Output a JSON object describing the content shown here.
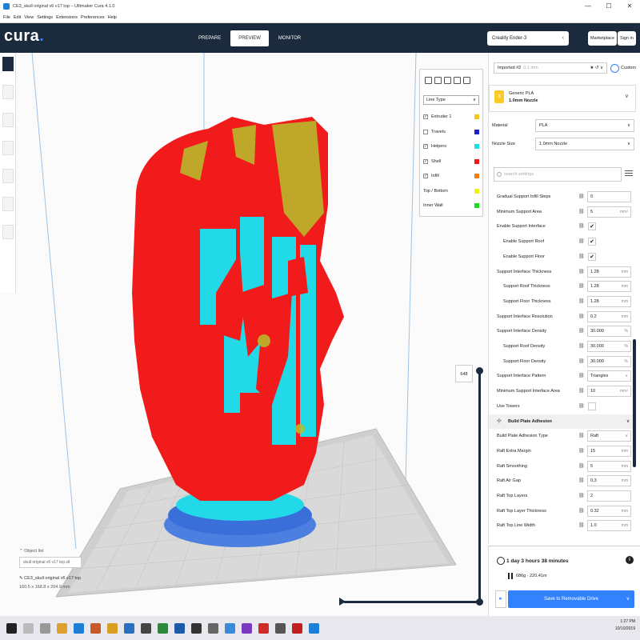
{
  "window": {
    "title": "CE3_skull original v6 v17 top – Ultimaker Cura 4.1.0",
    "controls": [
      "—",
      "☐",
      "✕"
    ]
  },
  "menu": [
    "File",
    "Edit",
    "View",
    "Settings",
    "Extensions",
    "Preferences",
    "Help"
  ],
  "header": {
    "logo": "cura",
    "stages": [
      "PREPARE",
      "PREVIEW",
      "MONITOR"
    ],
    "active_stage": "PREVIEW",
    "printer": "Creality Ender-3",
    "marketplace": "Marketplace",
    "signin": "Sign in"
  },
  "viewpanel": {
    "color_scheme": "Line Type",
    "rows": [
      {
        "label": "Extruder 1",
        "checked": true,
        "color": "#f5c518"
      },
      {
        "label": "Travels",
        "checked": false,
        "color": "#1f1fc8"
      },
      {
        "label": "Helpers",
        "checked": true,
        "color": "#1ee0e0"
      },
      {
        "label": "Shell",
        "checked": true,
        "color": "#f01818"
      },
      {
        "label": "Infill",
        "checked": true,
        "color": "#f08018"
      },
      {
        "label": "Top / Bottom",
        "checked": null,
        "color": "#f0f018"
      },
      {
        "label": "Inner Wall",
        "checked": null,
        "color": "#18e018"
      }
    ]
  },
  "layer": {
    "current": "648",
    "check": "✓"
  },
  "objects": {
    "header": "Object list",
    "item": "skull original v6 v17 top.stl",
    "file": "CE3_skull original v6 v17 top",
    "dims": "160.5 x 168.8 x 204.9 mm"
  },
  "panel": {
    "profile_name": "Imported #2",
    "profile_sub": "0.1 mm",
    "custom": "Custom",
    "extruder_num": "1",
    "material_name": "Generic PLA",
    "nozzle_name": "1.0mm Nozzle",
    "material_label": "Material",
    "material_value": "PLA",
    "nozzle_label": "Nozzle Size",
    "nozzle_value": "1.0mm Nozzle",
    "search_placeholder": "search settings",
    "settings": [
      {
        "label": "Gradual Support Infill Steps",
        "indent": 0,
        "type": "value",
        "value": "0",
        "unit": ""
      },
      {
        "label": "Minimum Support Area",
        "indent": 0,
        "type": "value",
        "value": "5",
        "unit": "mm²"
      },
      {
        "label": "Enable Support Interface",
        "indent": 0,
        "type": "check",
        "value": "✔",
        "unit": ""
      },
      {
        "label": "Enable Support Roof",
        "indent": 1,
        "type": "check",
        "value": "✔",
        "unit": ""
      },
      {
        "label": "Enable Support Floor",
        "indent": 1,
        "type": "check",
        "value": "✔",
        "unit": ""
      },
      {
        "label": "Support Interface Thickness",
        "indent": 0,
        "type": "value",
        "value": "1.28",
        "unit": "mm"
      },
      {
        "label": "Support Roof Thickness",
        "indent": 1,
        "type": "value",
        "value": "1.28",
        "unit": "mm"
      },
      {
        "label": "Support Floor Thickness",
        "indent": 1,
        "type": "value",
        "value": "1.28",
        "unit": "mm"
      },
      {
        "label": "Support Interface Resolution",
        "indent": 0,
        "type": "value",
        "value": "0.2",
        "unit": "mm"
      },
      {
        "label": "Support Interface Density",
        "indent": 0,
        "type": "value",
        "value": "30.000",
        "unit": "%"
      },
      {
        "label": "Support Roof Density",
        "indent": 1,
        "type": "value",
        "value": "30.000",
        "unit": "%"
      },
      {
        "label": "Support Floor Density",
        "indent": 1,
        "type": "value",
        "value": "30.000",
        "unit": "%"
      },
      {
        "label": "Support Interface Pattern",
        "indent": 0,
        "type": "select",
        "value": "Triangles",
        "unit": "∨"
      },
      {
        "label": "Minimum Support Interface Area",
        "indent": 0,
        "type": "value",
        "value": "10",
        "unit": "mm²"
      },
      {
        "label": "Use Towers",
        "indent": 0,
        "type": "check",
        "value": "",
        "unit": ""
      },
      {
        "label": "Build Plate Adhesion",
        "indent": 0,
        "type": "section",
        "value": "",
        "unit": ""
      },
      {
        "label": "Build Plate Adhesion Type",
        "indent": 0,
        "type": "select",
        "value": "Raft",
        "unit": "∨"
      },
      {
        "label": "Raft Extra Margin",
        "indent": 0,
        "type": "value",
        "value": "15",
        "unit": "mm"
      },
      {
        "label": "Raft Smoothing",
        "indent": 0,
        "type": "value",
        "value": "5",
        "unit": "mm"
      },
      {
        "label": "Raft Air Gap",
        "indent": 0,
        "type": "value",
        "value": "0.3",
        "unit": "mm"
      },
      {
        "label": "Raft Top Layers",
        "indent": 0,
        "type": "value",
        "value": "2",
        "unit": ""
      },
      {
        "label": "Raft Top Layer Thickness",
        "indent": 0,
        "type": "value",
        "value": "0.32",
        "unit": "mm"
      },
      {
        "label": "Raft Top Line Width",
        "indent": 0,
        "type": "value",
        "value": "1.0",
        "unit": "mm"
      }
    ]
  },
  "action": {
    "time": "1 day 3 hours 38 minutes",
    "material": "686g · 220.41m",
    "info": "i",
    "save": "Save to Removable Drive",
    "prev": "▸"
  },
  "taskbar": {
    "time": "1:27 PM",
    "date": "10/10/2019"
  }
}
